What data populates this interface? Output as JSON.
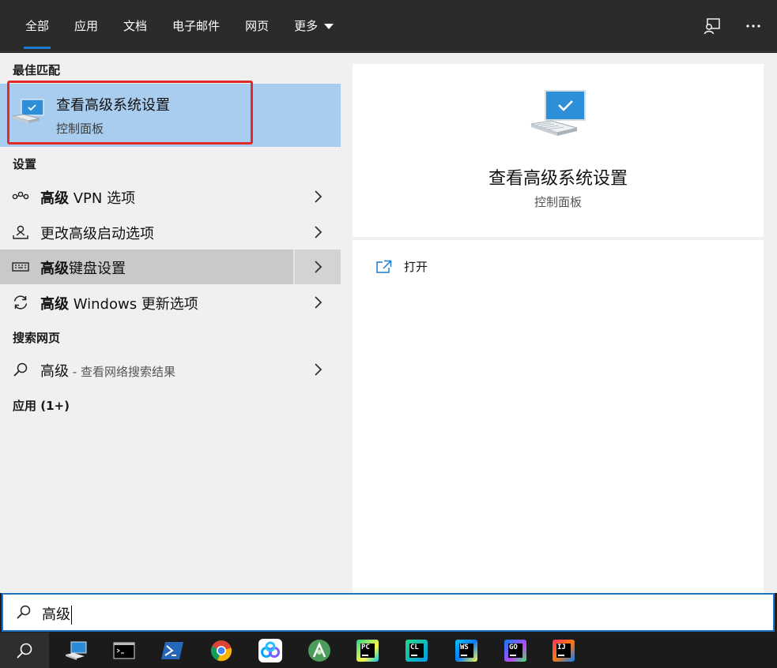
{
  "tabs": [
    {
      "label": "全部",
      "active": true
    },
    {
      "label": "应用"
    },
    {
      "label": "文档"
    },
    {
      "label": "电子邮件"
    },
    {
      "label": "网页"
    },
    {
      "label": "更多"
    }
  ],
  "top_icons": [
    "feedback-icon",
    "more-options-icon"
  ],
  "sections": {
    "best_match": "最佳匹配",
    "settings": "设置",
    "web": "搜索网页",
    "apps": "应用 (1+)"
  },
  "best_match": {
    "title": "查看高级系统设置",
    "subtitle": "控制面板",
    "icon": "computer-settings-icon"
  },
  "settings_items": [
    {
      "bold": "高级",
      "rest": " VPN 选项",
      "icon": "vpn-icon"
    },
    {
      "bold": "",
      "rest": "更改高级启动选项",
      "icon": "startup-icon"
    },
    {
      "bold": "高级",
      "rest": "键盘设置",
      "icon": "keyboard-icon"
    },
    {
      "bold": "高级",
      "rest": " Windows 更新选项",
      "icon": "update-icon"
    }
  ],
  "web_item": {
    "query": "高级",
    "suffix": " - 查看网络搜索结果",
    "icon": "search-icon"
  },
  "detail": {
    "title": "查看高级系统设置",
    "subtitle": "控制面板",
    "open_label": "打开"
  },
  "search": {
    "value": "高级"
  },
  "taskbar": {
    "apps": [
      "This PC",
      "Command Prompt",
      "PowerShell",
      "Google Chrome",
      "Baidu Netdisk",
      "Android Studio",
      "PyCharm",
      "CLion",
      "WebStorm",
      "GoLand",
      "IntelliJ IDEA"
    ],
    "labels": {
      "pycharm": "PC",
      "clion": "CL",
      "webstorm": "WS",
      "goland": "GO",
      "idea": "IJ"
    }
  },
  "colors": {
    "accent": "#1e7bd2",
    "selected_bg": "#a9cdee",
    "highlight_border": "#e02b2b",
    "panel_bg": "#f0f0f0",
    "topbar_bg": "#2b2b2b"
  }
}
